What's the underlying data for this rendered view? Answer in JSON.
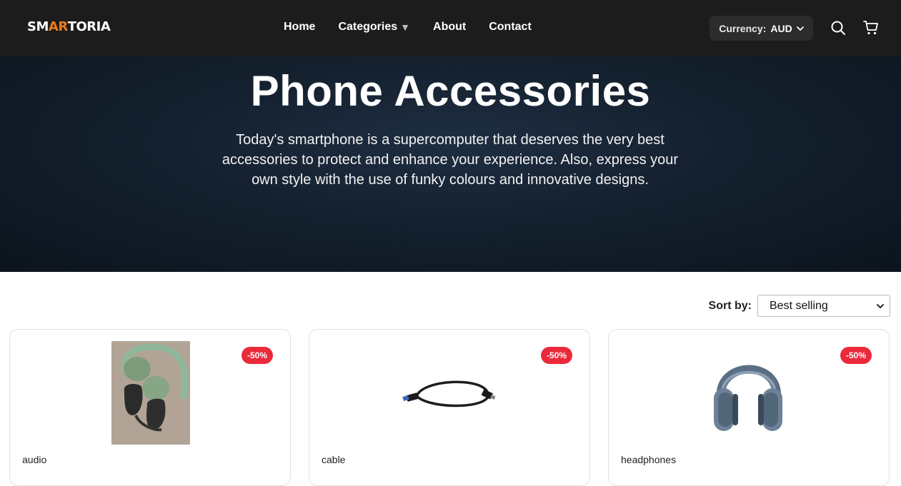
{
  "header": {
    "logo": {
      "part1": "SM",
      "accent": "AR",
      "part2": "TORIA"
    },
    "nav": [
      {
        "label": "Home"
      },
      {
        "label": "Categories",
        "caret": "▼"
      },
      {
        "label": "About"
      },
      {
        "label": "Contact"
      }
    ],
    "currency": {
      "label": "Currency:",
      "value": "AUD"
    },
    "icons": [
      "search-icon",
      "cart-icon"
    ]
  },
  "hero": {
    "title": "Phone Accessories",
    "description": "Today's smartphone is a supercomputer that deserves the very best accessories to protect and enhance your experience. Also, express your own style with the use of funky colours and innovative designs."
  },
  "sort": {
    "label": "Sort by:",
    "selected": "Best selling"
  },
  "products": [
    {
      "category": "audio",
      "badge": "-50%"
    },
    {
      "category": "cable",
      "badge": "-50%"
    },
    {
      "category": "headphones",
      "badge": "-50%"
    }
  ],
  "colors": {
    "header_bg": "#1c1c1c",
    "logo_accent": "#f07a1a",
    "badge": "#ea2a3b"
  }
}
